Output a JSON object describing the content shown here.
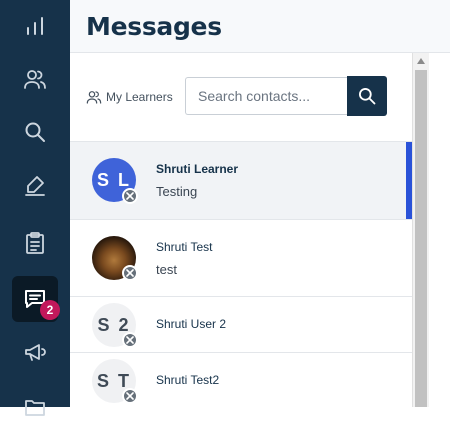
{
  "header": {
    "title": "Messages"
  },
  "nav": {
    "items": [
      {
        "icon": "bar-chart-icon"
      },
      {
        "icon": "users-icon"
      },
      {
        "icon": "search-icon"
      },
      {
        "icon": "pen-icon"
      },
      {
        "icon": "clipboard-icon"
      },
      {
        "icon": "chat-icon",
        "badge": "2"
      },
      {
        "icon": "megaphone-icon"
      },
      {
        "icon": "folder-icon"
      }
    ]
  },
  "toolbar": {
    "filter_label": "My Learners",
    "search_placeholder": "Search contacts..."
  },
  "contacts": [
    {
      "initials": "S L",
      "name": "Shruti Learner",
      "preview": "Testing",
      "avatar": "blue",
      "selected": true
    },
    {
      "initials": "",
      "name": "Shruti Test",
      "preview": "test",
      "avatar": "photo",
      "selected": false
    },
    {
      "initials": "S 2",
      "name": "Shruti User 2",
      "preview": "",
      "avatar": "light",
      "selected": false
    },
    {
      "initials": "S T",
      "name": "Shruti Test2",
      "preview": "",
      "avatar": "light",
      "selected": false
    }
  ],
  "colors": {
    "sidebar": "#16324a",
    "accent": "#2a52d8",
    "badge": "#c2185b"
  }
}
